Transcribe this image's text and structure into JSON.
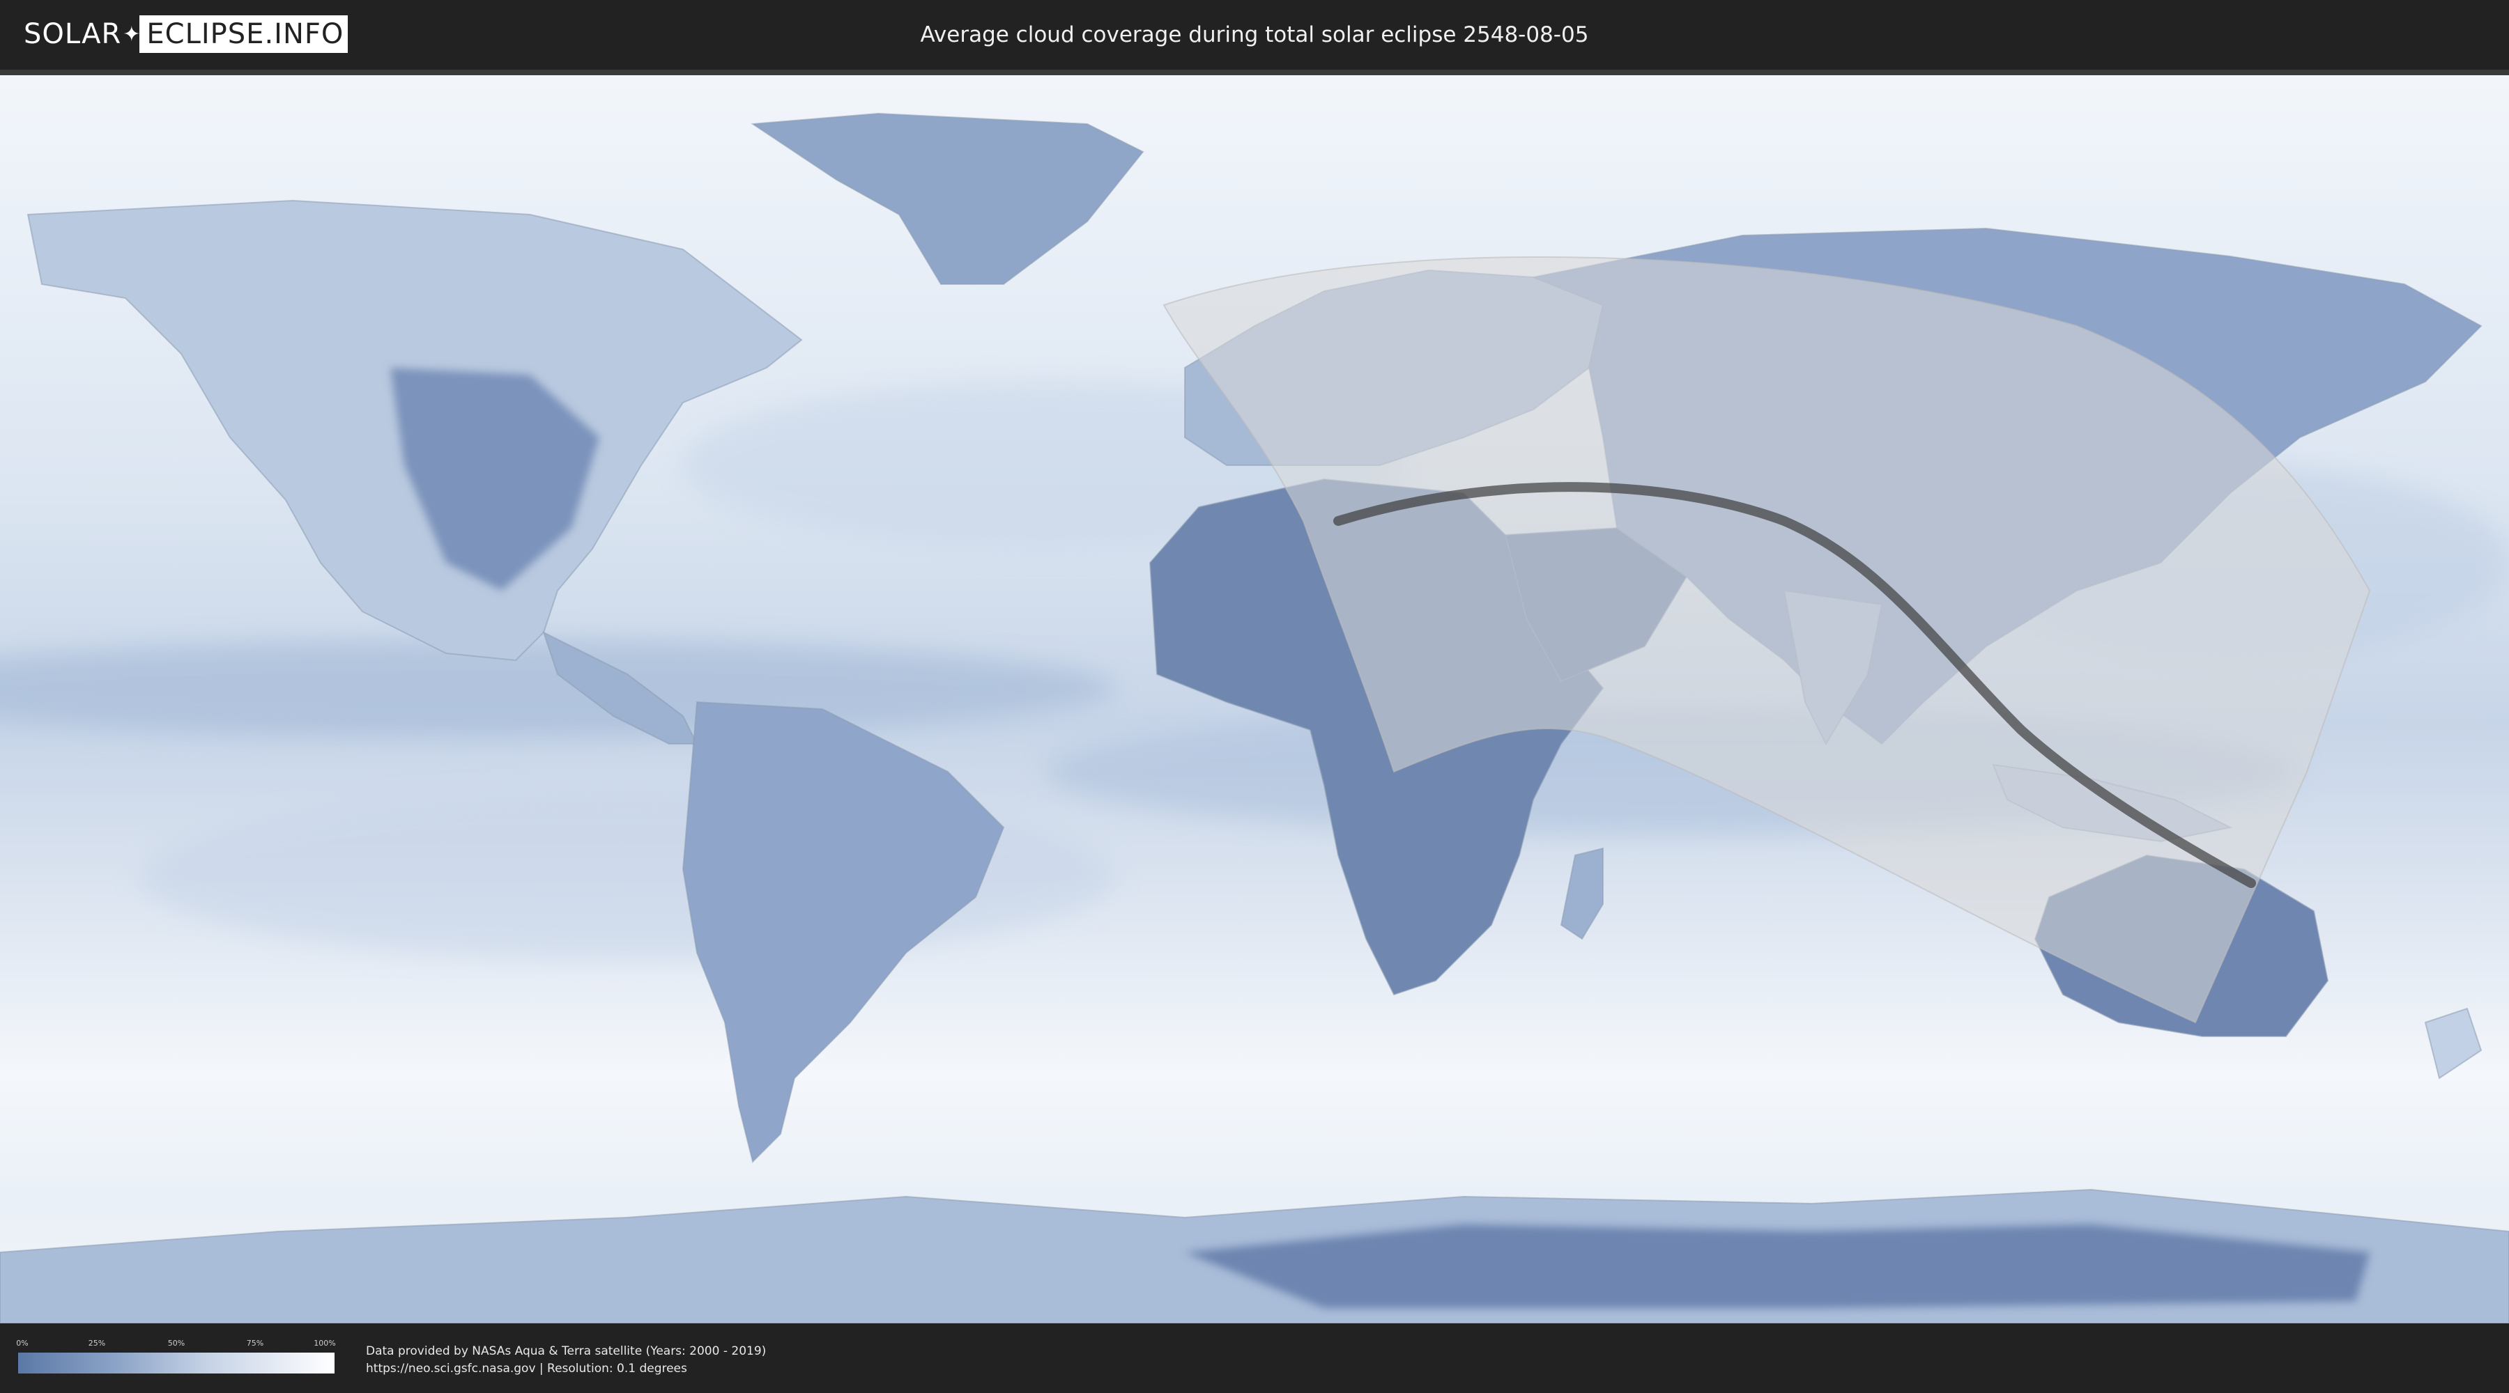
{
  "header": {
    "logo_part1": "SOLAR",
    "logo_part2": "ECLIPSE.INFO",
    "title": "Average cloud coverage during total solar eclipse 2548-08-05"
  },
  "map": {
    "kind": "world-cloud-coverage",
    "colors": {
      "clear": "#5b78a6",
      "cloudy": "#ffffff",
      "path_band": "#d9d9d9",
      "path_centerline": "#3d3d3d"
    }
  },
  "legend": {
    "ticks": [
      "0%",
      "25%",
      "50%",
      "75%",
      "100%"
    ]
  },
  "footer": {
    "credit_line1": "Data provided by NASAs Aqua & Terra satellite (Years: 2000 - 2019)",
    "credit_line2": "https://neo.sci.gsfc.nasa.gov | Resolution: 0.1 degrees"
  }
}
